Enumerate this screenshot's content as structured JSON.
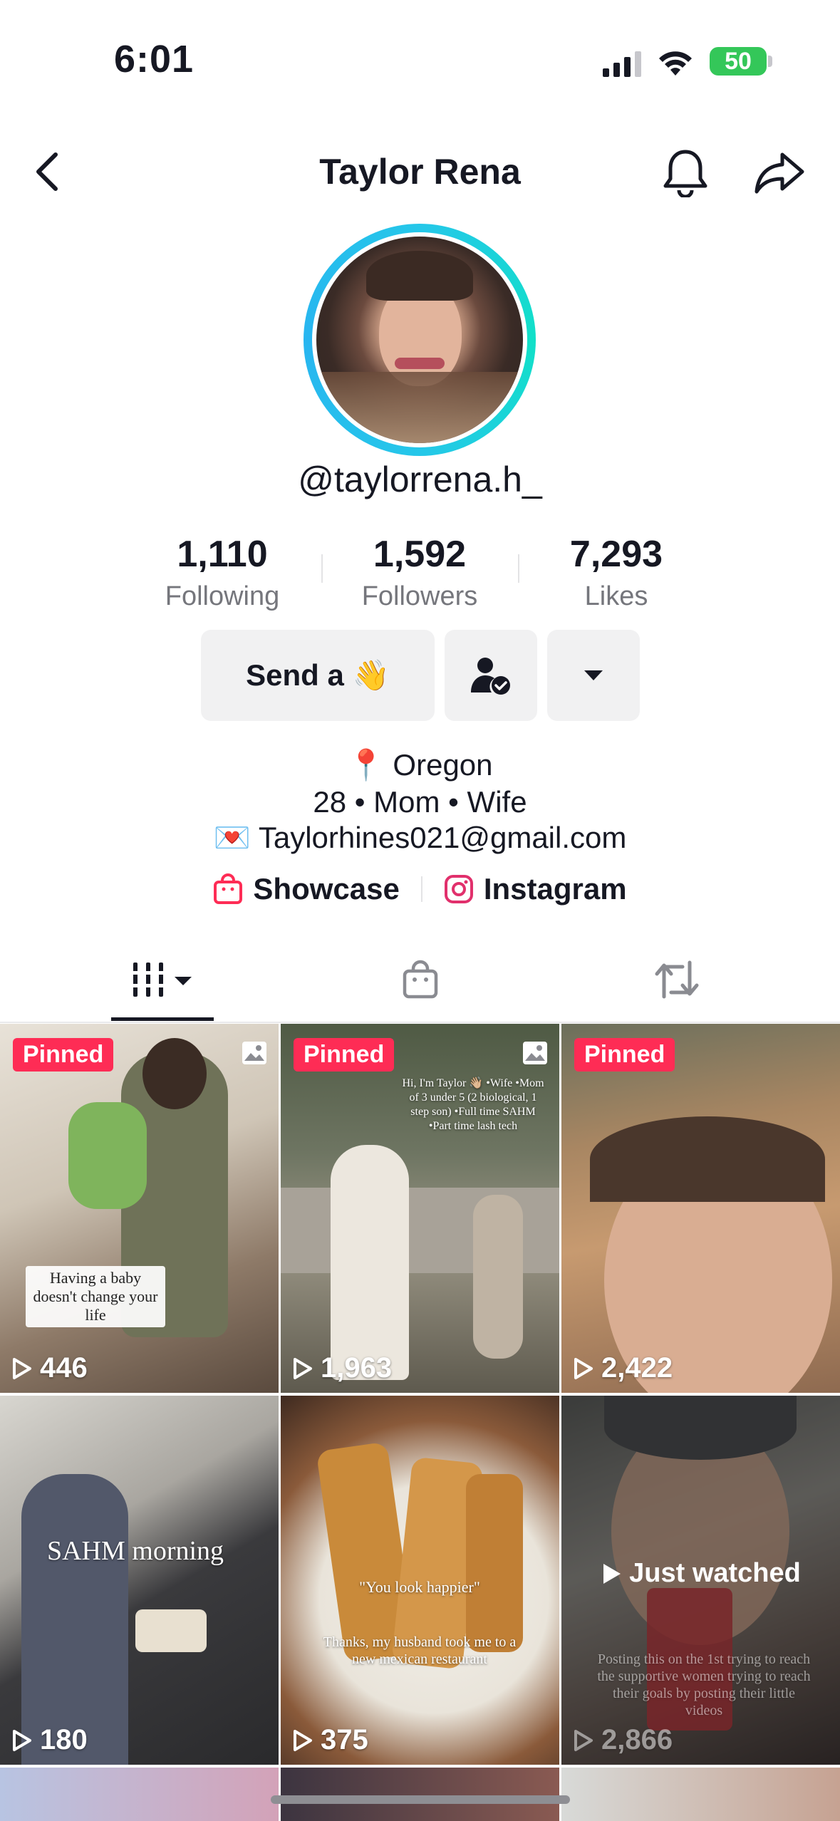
{
  "status_bar": {
    "time": "6:01",
    "battery": "50"
  },
  "header": {
    "title": "Taylor Rena"
  },
  "profile": {
    "handle": "@taylorrena.h_",
    "stats": [
      {
        "value": "1,110",
        "label": "Following"
      },
      {
        "value": "1,592",
        "label": "Followers"
      },
      {
        "value": "7,293",
        "label": "Likes"
      }
    ],
    "send_button": "Send a 👋",
    "bio": {
      "location": "📍 Oregon",
      "line2": "28 • Mom • Wife",
      "email": "💌 Taylorhines021@gmail.com"
    },
    "links": {
      "showcase": "Showcase",
      "instagram": "Instagram"
    }
  },
  "tabs": [
    "videos-tab",
    "shop-tab",
    "reposts-tab"
  ],
  "grid": [
    {
      "pinned": "Pinned",
      "views": "446",
      "caption": "Having a baby doesn't change your life"
    },
    {
      "pinned": "Pinned",
      "views": "1,963",
      "caption": "Hi, I'm Taylor 👋🏼 •Wife •Mom of 3 under 5 (2 biological, 1 step son) •Full time SAHM •Part time lash tech"
    },
    {
      "pinned": "Pinned",
      "views": "2,422",
      "caption": ""
    },
    {
      "pinned": "",
      "views": "180",
      "caption": "SAHM morning"
    },
    {
      "pinned": "",
      "views": "375",
      "caption_top": "\"You look happier\"",
      "caption": "Thanks, my husband took me to a new mexican restaurant"
    },
    {
      "pinned": "",
      "views": "2,866",
      "overlay": "Just watched",
      "caption": "Posting this on the 1st trying to reach the supportive women trying to reach their goals by posting their little videos"
    }
  ],
  "colors": {
    "accent": "#fe2c55",
    "ring": "#25c7e9",
    "battery": "#34c759"
  }
}
